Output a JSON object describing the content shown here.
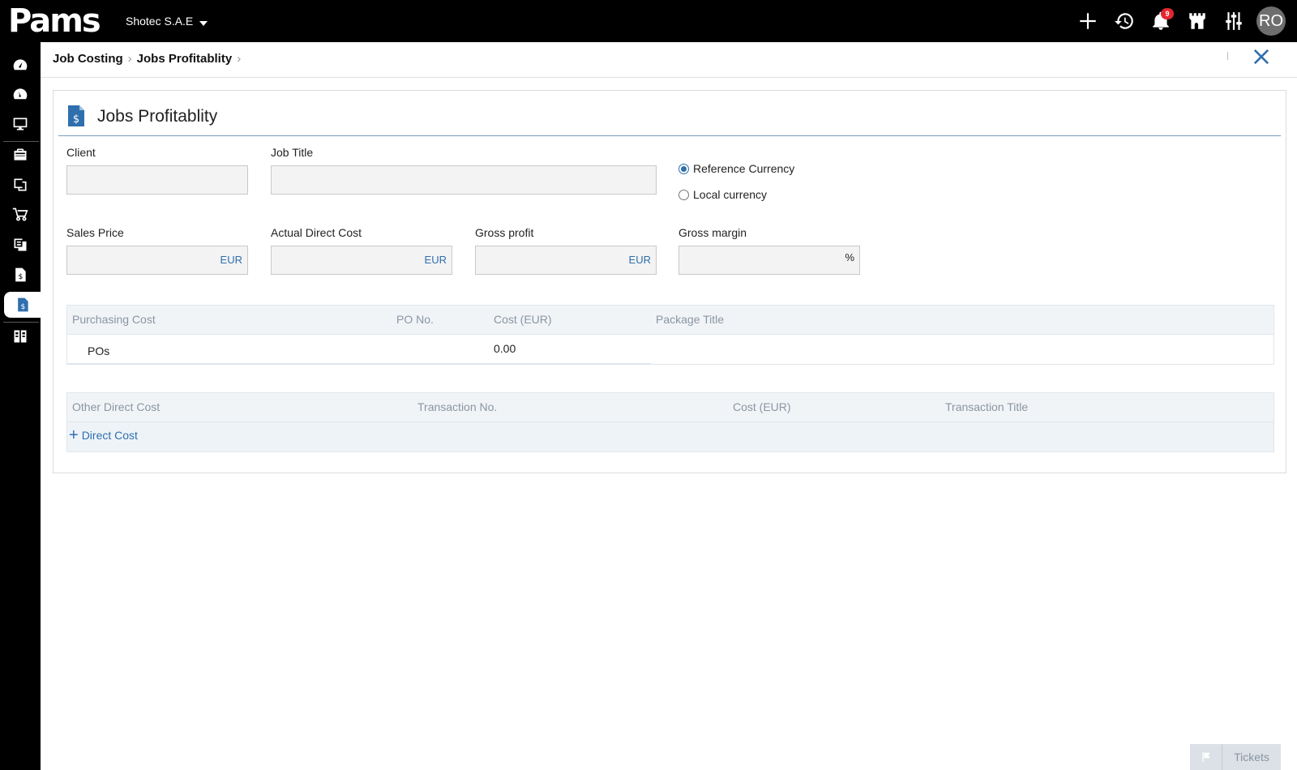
{
  "app": {
    "logo": "Pams",
    "company": "Shotec S.A.E"
  },
  "topbar": {
    "notifications_count": "9",
    "avatar_initials": "RO"
  },
  "breadcrumb": {
    "items": [
      "Job Costing",
      "Jobs Profitablity"
    ]
  },
  "page": {
    "title": "Jobs Profitablity",
    "fields": {
      "client": {
        "label": "Client",
        "value": ""
      },
      "job_title": {
        "label": "Job Title",
        "value": ""
      },
      "sales_price": {
        "label": "Sales Price",
        "value": "",
        "suffix": "EUR"
      },
      "actual_direct_cost": {
        "label": "Actual Direct Cost",
        "value": "",
        "suffix": "EUR"
      },
      "gross_profit": {
        "label": "Gross profit",
        "value": "",
        "suffix": "EUR"
      },
      "gross_margin": {
        "label": "Gross margin",
        "value": "",
        "suffix": "%"
      }
    },
    "currency": {
      "options": [
        "Reference Currency",
        "Local currency"
      ],
      "selected": "Reference Currency"
    },
    "purchasing_table": {
      "headers": [
        "Purchasing Cost",
        "PO No.",
        "Cost (EUR)",
        "Package Title"
      ],
      "rows": [
        {
          "label": "POs",
          "po_no": "",
          "cost": "0.00",
          "package_title": ""
        }
      ]
    },
    "other_cost_table": {
      "headers": [
        "Other Direct Cost",
        "Transaction No.",
        "Cost (EUR)",
        "Transaction Title"
      ],
      "add_label": "Direct Cost"
    }
  },
  "tickets": {
    "label": "Tickets"
  },
  "colors": {
    "accent": "#2f6fad",
    "topbar": "#000000",
    "badge": "#e3262f"
  }
}
